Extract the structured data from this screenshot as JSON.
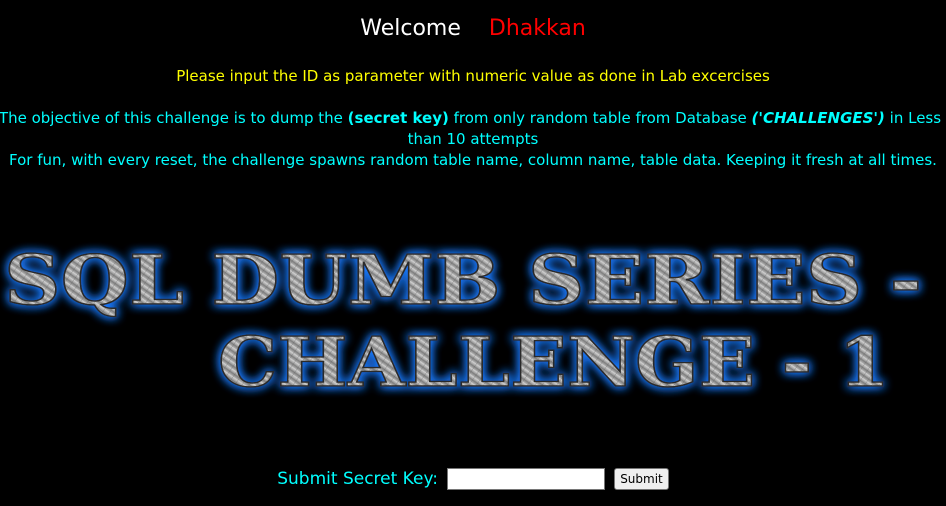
{
  "header": {
    "welcome_label": "Welcome",
    "username": "Dhakkan"
  },
  "instructions": {
    "input_hint": "Please input the ID as parameter with numeric value as done in Lab excercises",
    "objective_part1": "The objective of this challenge is to dump the ",
    "objective_secret": "(secret key)",
    "objective_part2": " from only random table from Database ",
    "objective_db": "('CHALLENGES')",
    "objective_part3": " in Less",
    "objective_line2": "than 10 attempts",
    "objective_line3": "For fun, with every reset, the challenge spawns random table name, column name, table data. Keeping it fresh at all times."
  },
  "banner": {
    "line1": "SQL DUMB SERIES - 1",
    "line2": "CHALLENGE - 1"
  },
  "form": {
    "label": "Submit Secret Key:",
    "input_value": "",
    "submit_label": "Submit"
  },
  "colors": {
    "background": "#000000",
    "welcome": "#ffffff",
    "username": "#ff0000",
    "hint": "#ffff00",
    "objective": "#00ffff",
    "banner_glow": "#1e7bff"
  }
}
